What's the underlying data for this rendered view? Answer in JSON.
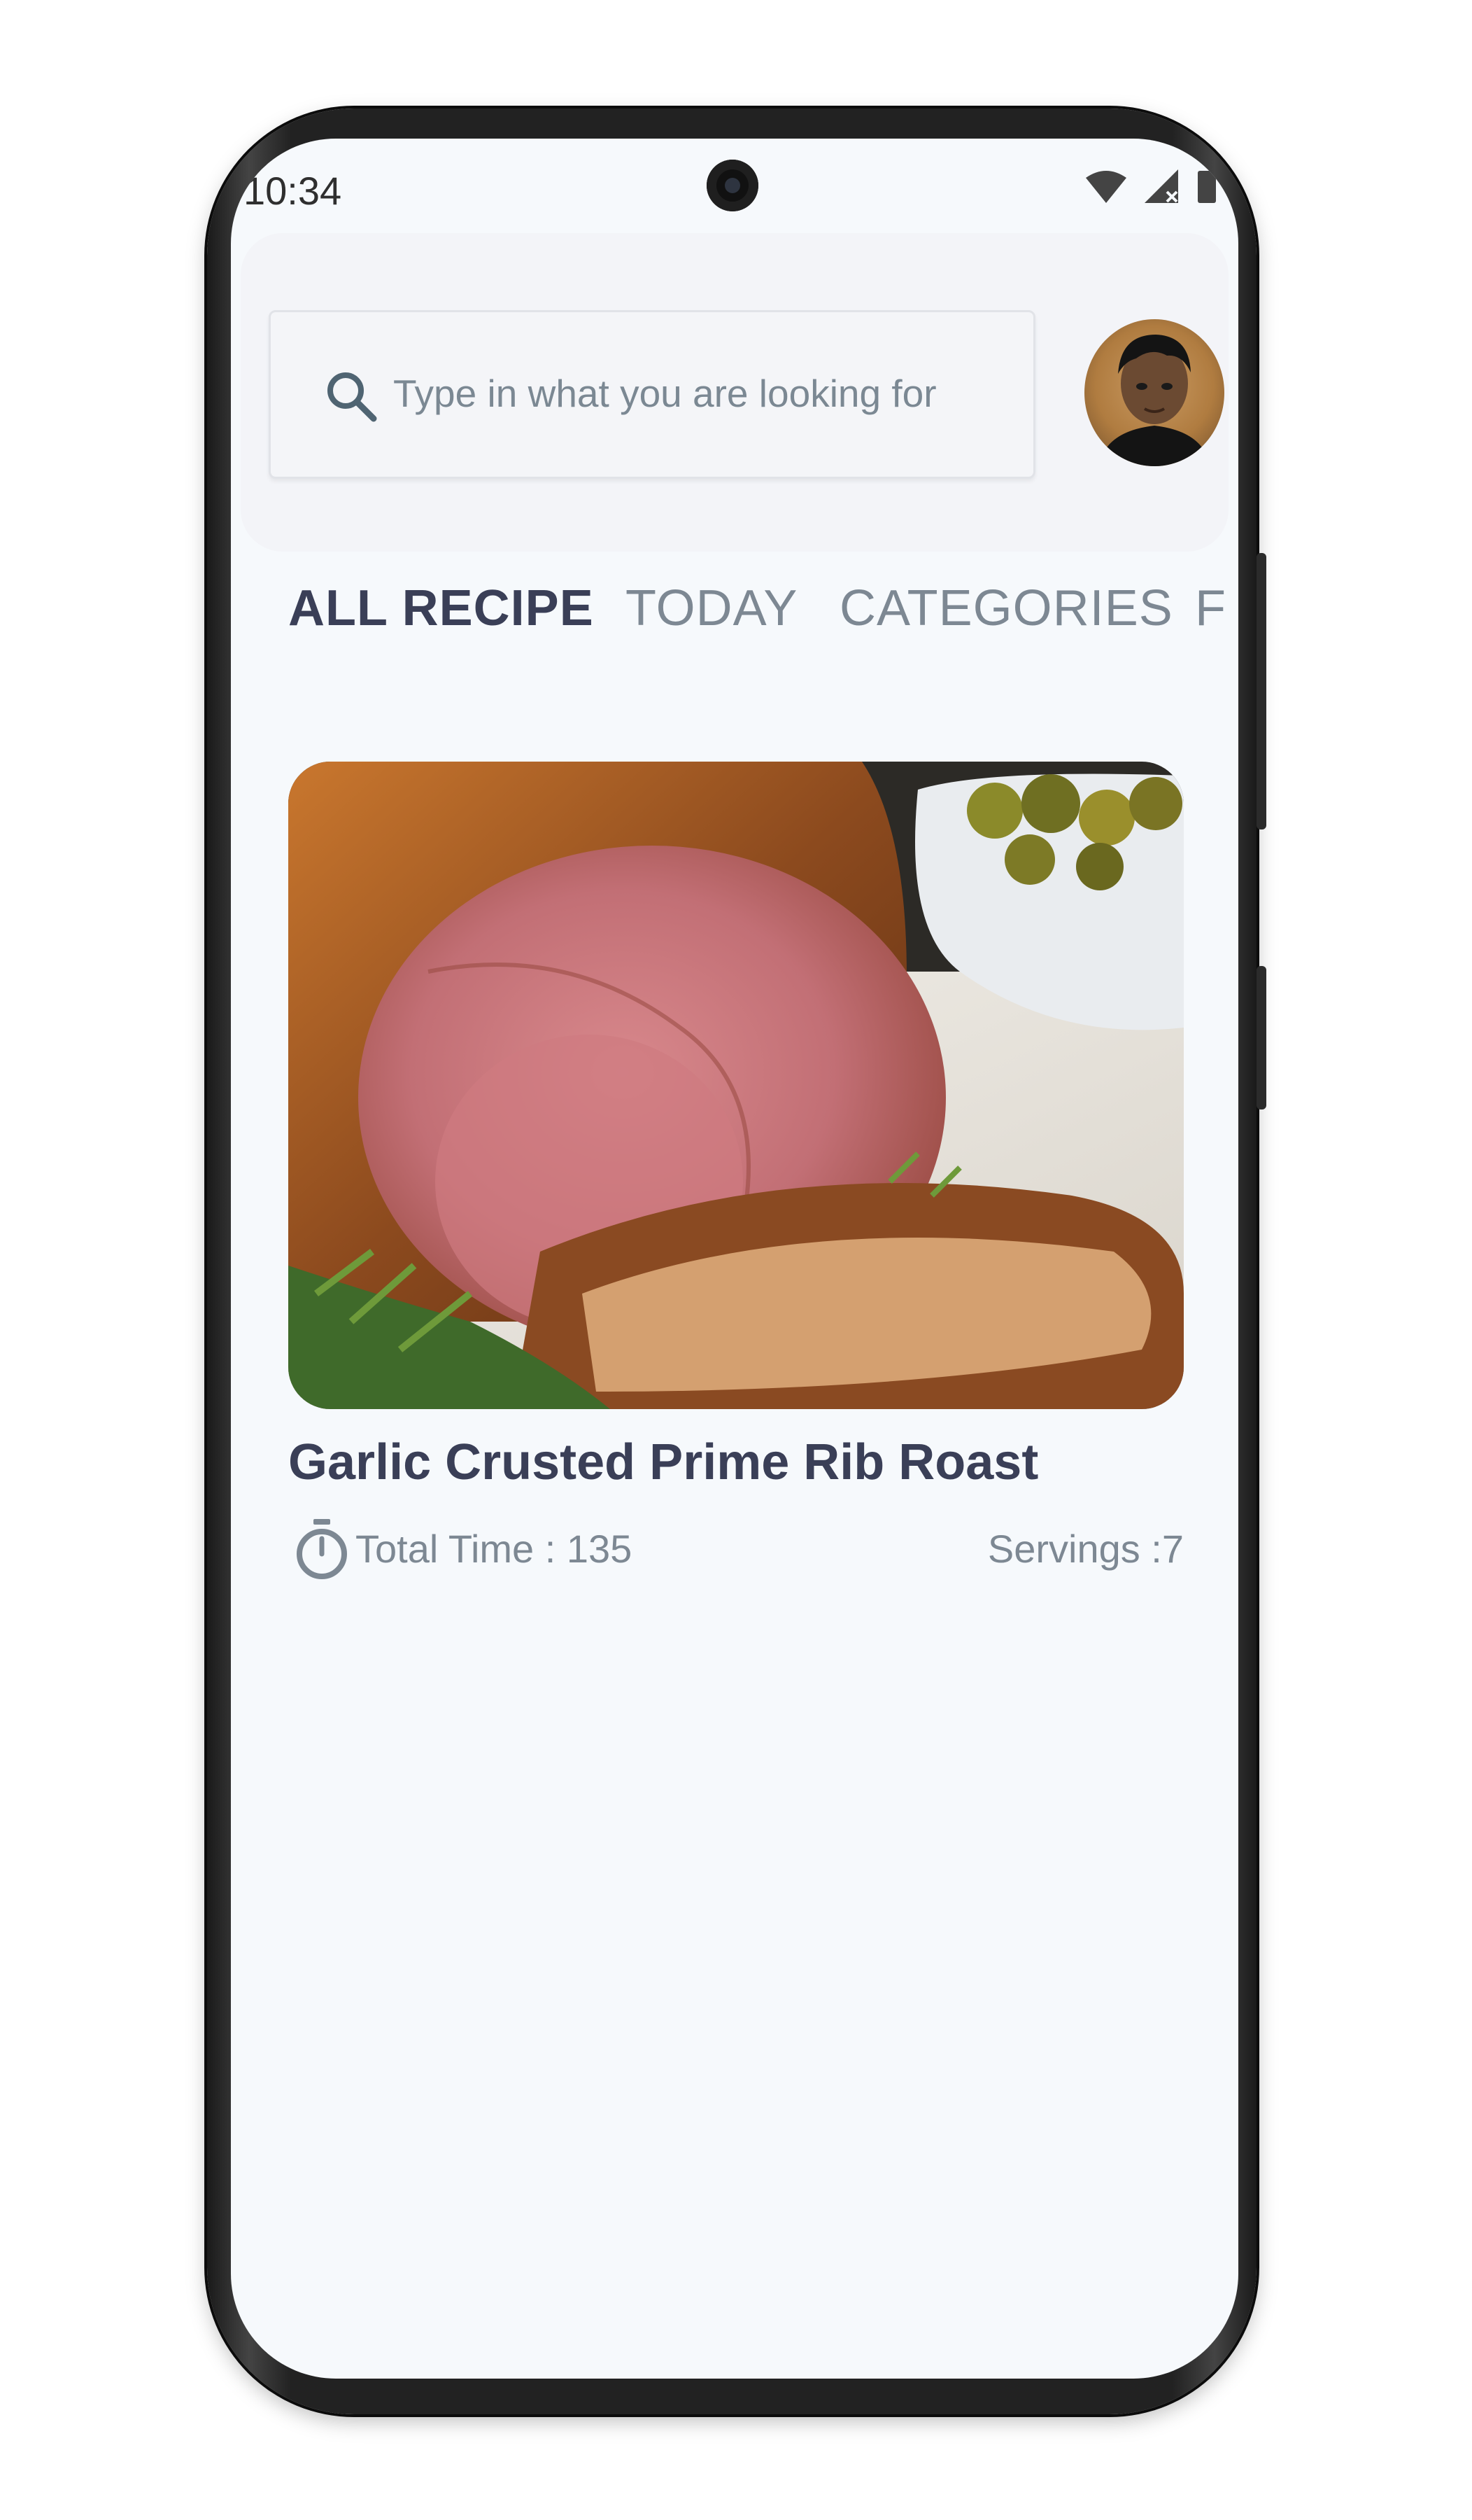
{
  "status_bar": {
    "time": "10:34",
    "icons": [
      "wifi-icon",
      "signal-icon",
      "battery-icon"
    ]
  },
  "search": {
    "placeholder": "Type in what you are looking for",
    "icon": "search-icon"
  },
  "profile": {
    "avatar_icon": "avatar"
  },
  "tabs": [
    {
      "label": "ALL RECIPE",
      "active": true
    },
    {
      "label": "TODAY",
      "active": false
    },
    {
      "label": "CATEGORIES",
      "active": false
    },
    {
      "label": "F",
      "active": false
    }
  ],
  "recipes": [
    {
      "title": "Garlic Crusted Prime Rib Roast",
      "total_time": "Total Time : 135",
      "servings": "Servings :7",
      "image_icon": "recipe-photo"
    }
  ],
  "colors": {
    "background": "#f6f9fc",
    "title": "#3a3f57",
    "muted": "#7d8893"
  }
}
